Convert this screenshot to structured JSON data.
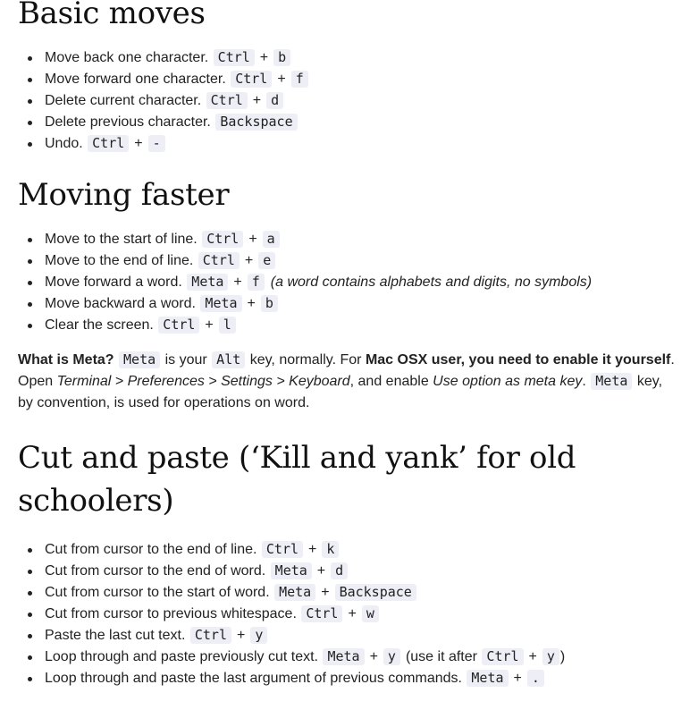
{
  "sections": {
    "basic": {
      "title": "Basic moves",
      "items": [
        {
          "text": "Move back one character.",
          "k1": "Ctrl",
          "k2": "b"
        },
        {
          "text": "Move forward one character.",
          "k1": "Ctrl",
          "k2": "f"
        },
        {
          "text": "Delete current character.",
          "k1": "Ctrl",
          "k2": "d"
        },
        {
          "text": "Delete previous character.",
          "k1": "Backspace"
        },
        {
          "text": "Undo.",
          "k1": "Ctrl",
          "k2": "-"
        }
      ]
    },
    "faster": {
      "title": "Moving faster",
      "items": [
        {
          "text": "Move to the start of line.",
          "k1": "Ctrl",
          "k2": "a"
        },
        {
          "text": "Move to the end of line.",
          "k1": "Ctrl",
          "k2": "e"
        },
        {
          "text": "Move forward a word.",
          "k1": "Meta",
          "k2": "f",
          "note": "(a word contains alphabets and digits, no symbols)"
        },
        {
          "text": "Move backward a word.",
          "k1": "Meta",
          "k2": "b"
        },
        {
          "text": "Clear the screen.",
          "k1": "Ctrl",
          "k2": "l"
        }
      ]
    },
    "cut": {
      "title": "Cut and paste (‘Kill and yank’ for old schoolers)",
      "items": [
        {
          "text": "Cut from cursor to the end of line.",
          "k1": "Ctrl",
          "k2": "k"
        },
        {
          "text": "Cut from cursor to the end of word.",
          "k1": "Meta",
          "k2": "d"
        },
        {
          "text": "Cut from cursor to the start of word.",
          "k1": "Meta",
          "k2": "Backspace"
        },
        {
          "text": "Cut from cursor to previous whitespace.",
          "k1": "Ctrl",
          "k2": "w"
        },
        {
          "text": "Paste the last cut text.",
          "k1": "Ctrl",
          "k2": "y"
        },
        {
          "text": "Loop through and paste previously cut text.",
          "k1": "Meta",
          "k2": "y",
          "after_pre": "(use it after",
          "k3": "Ctrl",
          "k4": "y",
          "after_post": ")"
        },
        {
          "text": "Loop through and paste the last argument of previous commands.",
          "k1": "Meta",
          "k2": "."
        }
      ]
    }
  },
  "plus": "+",
  "meta_note": {
    "q": "What is Meta?",
    "meta_key": "Meta",
    "t1": "is your",
    "alt_key": "Alt",
    "t2": "key, normally. For",
    "mac_bold": "Mac OSX user, you need to enable it yourself",
    "t3": ". Open",
    "path": "Terminal > Preferences > Settings > Keyboard",
    "t4": ", and enable",
    "option": "Use option as meta key",
    "t5": ".",
    "meta_key2": "Meta",
    "t6": "key, by convention, is used for operations on word."
  }
}
